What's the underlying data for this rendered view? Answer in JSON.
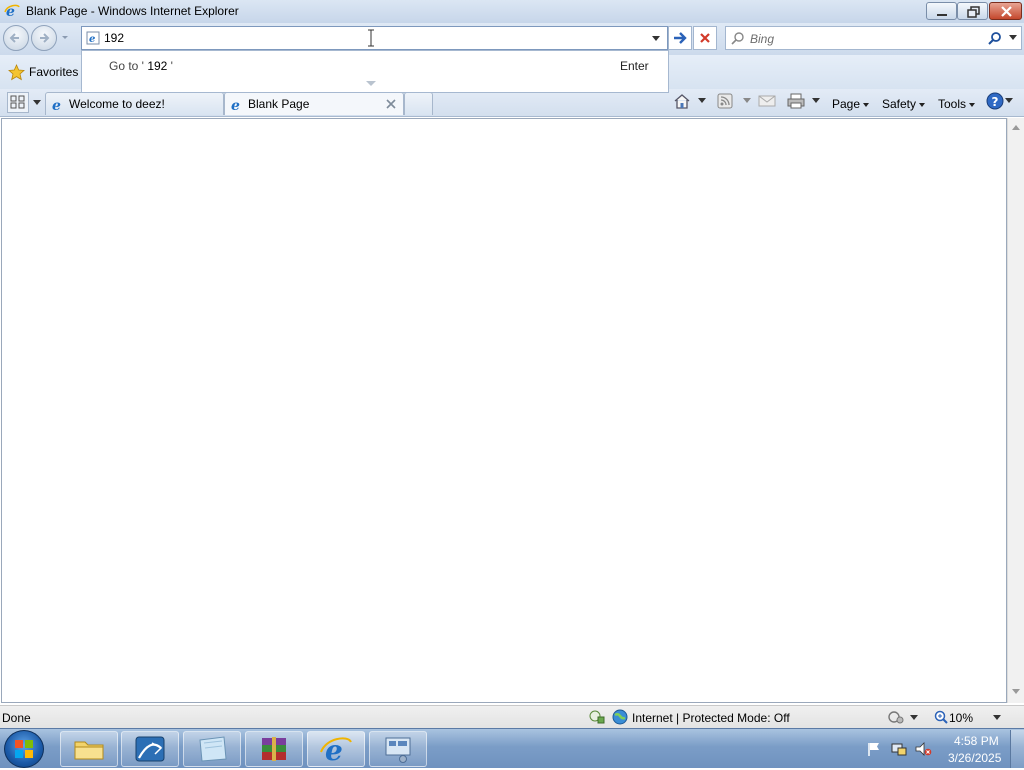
{
  "window": {
    "title": "Blank Page - Windows Internet Explorer"
  },
  "address_bar": {
    "value": "192"
  },
  "search": {
    "placeholder": "Bing"
  },
  "favorites": {
    "label": "Favorites"
  },
  "autocomplete": {
    "goto_prefix": "Go to ' ",
    "goto_value": "192",
    "goto_suffix": " '",
    "shortcut": "Enter"
  },
  "tabs": [
    {
      "label": "Welcome to deez!"
    },
    {
      "label": "Blank Page"
    }
  ],
  "command_bar": {
    "page": "Page",
    "safety": "Safety",
    "tools": "Tools"
  },
  "status": {
    "text": "Done",
    "zone": "Internet | Protected Mode: Off",
    "zoom": "10%"
  },
  "taskbar": {
    "time": "4:58 PM",
    "date": "3/26/2025"
  },
  "colors": {
    "close_button": "#c4482d",
    "ie_blue": "#1f6fc5",
    "taskbar": "#7b9dc7"
  }
}
